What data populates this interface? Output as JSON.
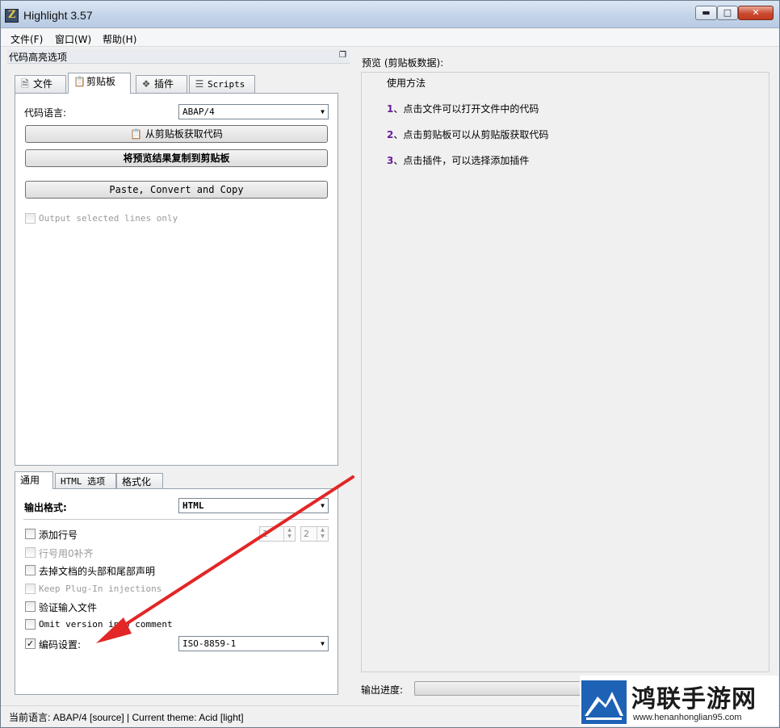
{
  "window": {
    "title": "Highlight 3.57"
  },
  "window_controls": {
    "minimize": "▬",
    "maximize": "□",
    "close": "✕"
  },
  "menu": [
    {
      "label": "文件(F)"
    },
    {
      "label": "窗口(W)"
    },
    {
      "label": "帮助(H)"
    }
  ],
  "left_panel": {
    "title": "代码高亮选项",
    "float_icon": "restore-icon"
  },
  "top_tabs": [
    {
      "label": "文件",
      "icon": "document-icon"
    },
    {
      "label": "剪贴板",
      "icon": "clipboard-icon"
    },
    {
      "label": "插件",
      "icon": "puzzle-icon"
    },
    {
      "label": "Scripts",
      "icon": "script-icon"
    }
  ],
  "clipboard": {
    "lang_label": "代码语言:",
    "lang_value": "ABAP/4",
    "get_from_clipboard": "从剪贴板获取代码",
    "copy_preview": "将预览结果复制到剪贴板",
    "paste_convert_copy": "Paste, Convert and Copy",
    "output_selected_lines": "Output selected lines only"
  },
  "bottom_tabs": [
    {
      "label": "通用"
    },
    {
      "label": "HTML 选项"
    },
    {
      "label": "格式化"
    }
  ],
  "general": {
    "output_format_label": "输出格式:",
    "output_format_value": "HTML",
    "add_line_numbers": "添加行号",
    "line_start": "1",
    "line_width": "2",
    "pad_zero": "行号用0补齐",
    "omit_header_footer": "去掉文档的头部和尾部声明",
    "keep_plugin_injections": "Keep Plug-In injections",
    "validate_input": "验证输入文件",
    "omit_version_info": "Omit version info comment",
    "encoding_label": "编码设置:",
    "encoding_value": "ISO-8859-1",
    "encoding_checked": true
  },
  "preview": {
    "title": "预览 (剪贴板数据):",
    "heading": "使用方法",
    "steps": [
      {
        "num": "1",
        "text": "、点击文件可以打开文件中的代码"
      },
      {
        "num": "2",
        "text": "、点击剪贴板可以从剪贴版获取代码"
      },
      {
        "num": "3",
        "text": "、点击插件，可以选择添加插件"
      }
    ],
    "progress_label": "输出进度:"
  },
  "status": {
    "text": "当前语言: ABAP/4  [source] | Current theme: Acid  [light]"
  },
  "watermark": {
    "title": "鸿联手游网",
    "url": "www.henanhonglian95.com"
  }
}
